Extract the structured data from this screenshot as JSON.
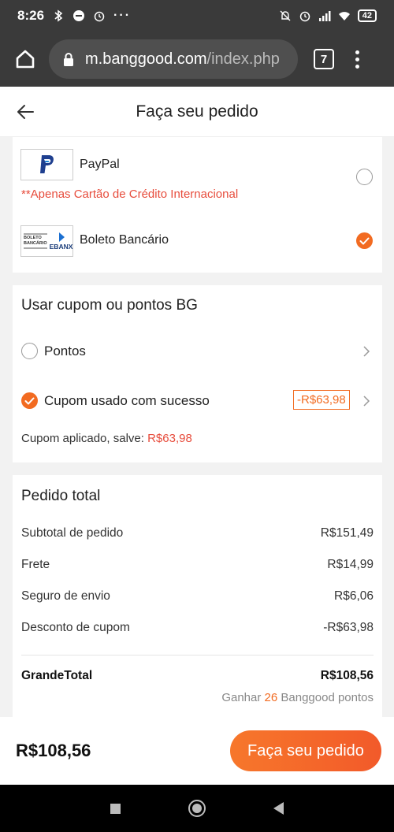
{
  "status_bar": {
    "time": "8:26",
    "overflow": "···",
    "battery": "42",
    "icons": [
      "bluetooth-icon",
      "dnd-icon",
      "alarm-icon",
      "mute-icon",
      "alarm-icon",
      "signal-icon",
      "wifi-icon",
      "battery-icon"
    ]
  },
  "browser": {
    "url_host": "m.banggood.com",
    "url_path": "/index.php",
    "tab_count": "7"
  },
  "header": {
    "title": "Faça seu pedido"
  },
  "payment": {
    "methods": [
      {
        "label": "PayPal",
        "note": "**Apenas Cartão de Crédito Internacional",
        "selected": false
      },
      {
        "label": "Boleto Bancário",
        "logo_text_1": "BOLETO",
        "logo_text_2": "BANCÁRIO",
        "logo_text_3": "EBANX",
        "selected": true
      }
    ]
  },
  "coupon": {
    "title": "Usar cupom ou pontos BG",
    "points_label": "Pontos",
    "coupon_label": "Cupom usado com sucesso",
    "coupon_value": "-R$63,98",
    "applied_prefix": "Cupom aplicado, salve: ",
    "applied_amount": "R$63,98"
  },
  "order_total": {
    "title": "Pedido total",
    "rows": [
      {
        "label": "Subtotal de pedido",
        "value": "R$151,49"
      },
      {
        "label": "Frete",
        "value": "R$14,99"
      },
      {
        "label": "Seguro de envio",
        "value": "R$6,06"
      },
      {
        "label": "Desconto de cupom",
        "value": "-R$63,98"
      }
    ],
    "grand_label": "GrandeTotal",
    "grand_value": "R$108,56",
    "earn_prefix": "Ganhar ",
    "earn_points": "26",
    "earn_suffix": " Banggood pontos"
  },
  "bottom": {
    "price": "R$108,56",
    "button": "Faça seu pedido"
  },
  "colors": {
    "accent": "#f26b21",
    "warning": "#e74c3c",
    "status_bar": "#3a3a3a"
  }
}
